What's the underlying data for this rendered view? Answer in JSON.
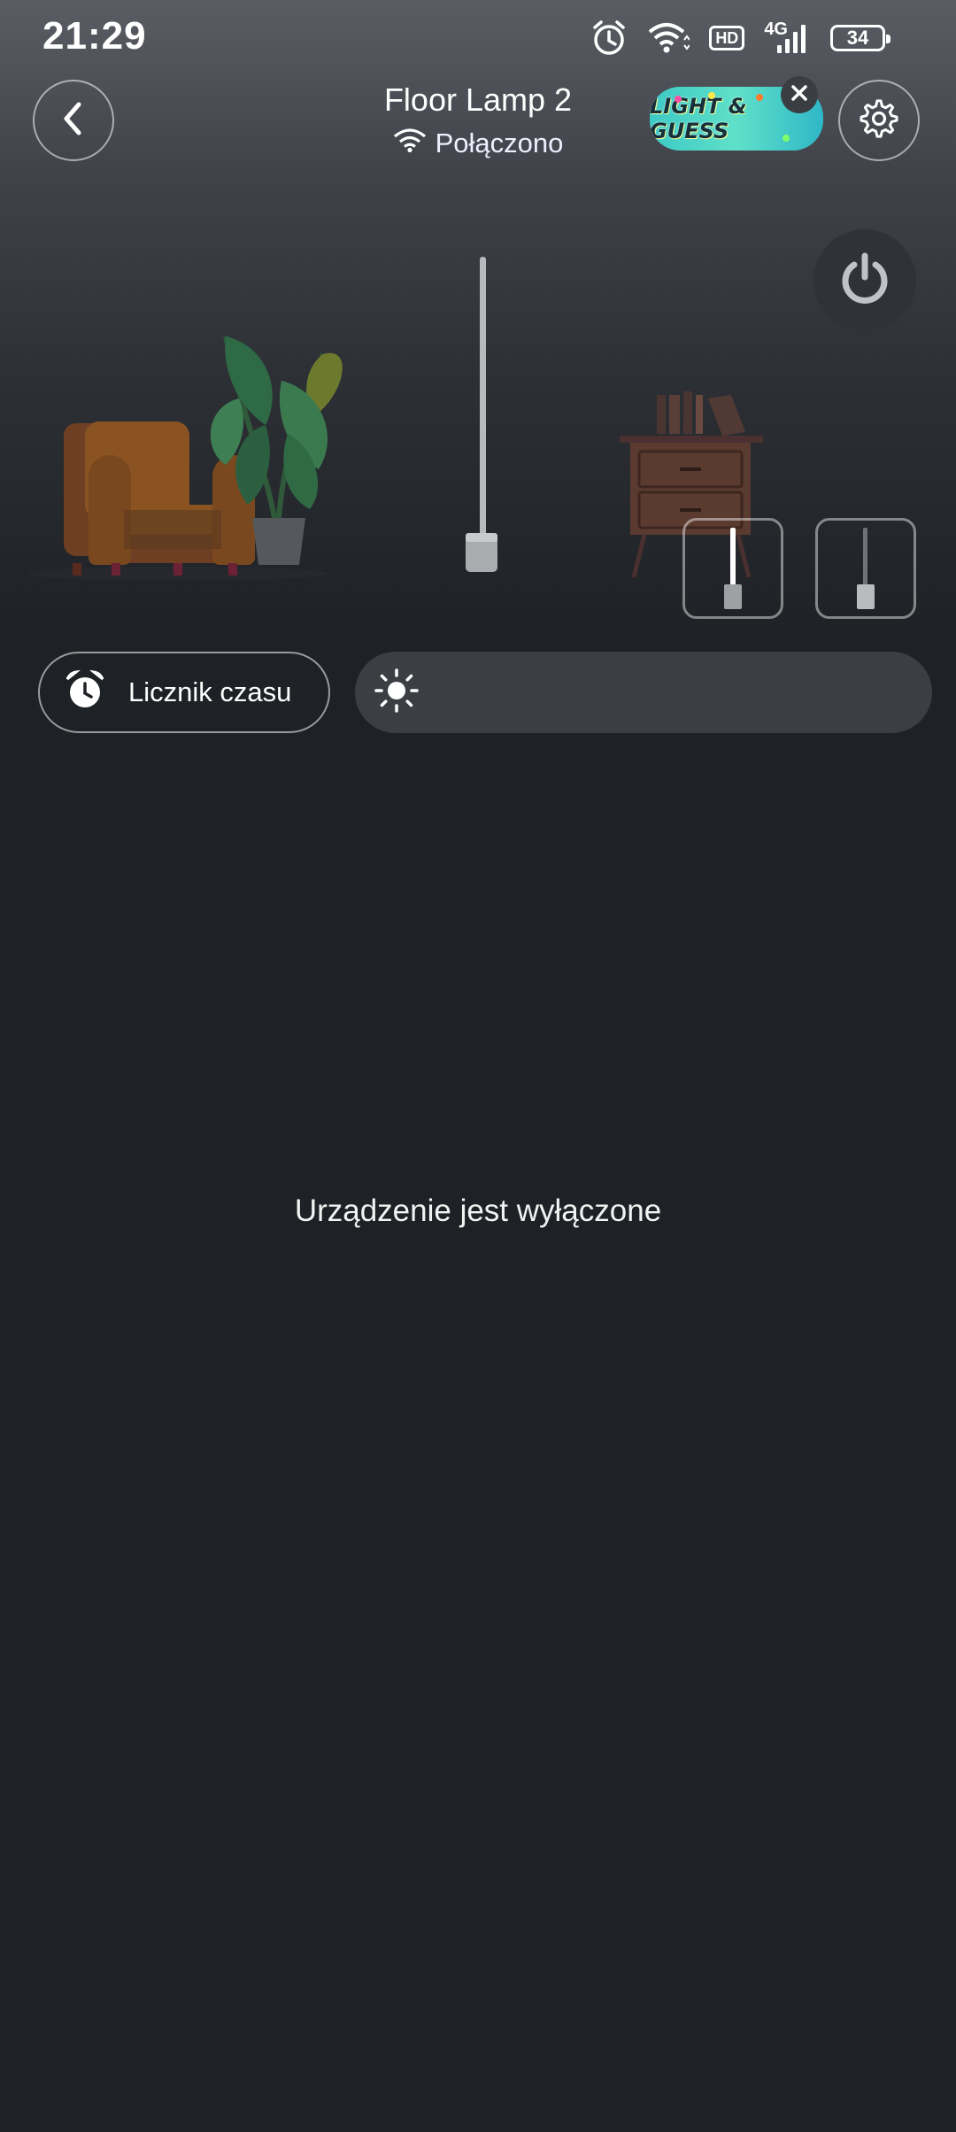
{
  "status_bar": {
    "time": "21:29",
    "hd_label": "HD",
    "network_type": "4G",
    "battery_level": "34",
    "icons": [
      "alarm-icon",
      "wifi-icon",
      "hd-icon",
      "signal-icon",
      "battery-icon"
    ]
  },
  "header": {
    "title": "Floor Lamp 2",
    "connection_status": "Połączono",
    "back_icon": "chevron-left-icon",
    "settings_icon": "gear-icon"
  },
  "promo_banner": {
    "text": "LIGHT & GUESS",
    "close_icon": "close-icon"
  },
  "power": {
    "icon": "power-icon",
    "state": "off"
  },
  "modes": [
    {
      "name": "lamp-mode-on",
      "icon": "floor-lamp-lit-icon"
    },
    {
      "name": "lamp-mode-off",
      "icon": "floor-lamp-unlit-icon"
    }
  ],
  "controls": {
    "timer_label": "Licznik czasu",
    "timer_icon": "alarm-clock-icon",
    "brightness_icon": "sun-icon",
    "brightness_value": 0
  },
  "main": {
    "device_off_message": "Urządzenie jest wyłączone"
  },
  "colors": {
    "background": "#1e2125",
    "hero_top": "#5a5d64",
    "slider_bg": "#3b3f44",
    "power_btn_bg": "#2f3237"
  }
}
